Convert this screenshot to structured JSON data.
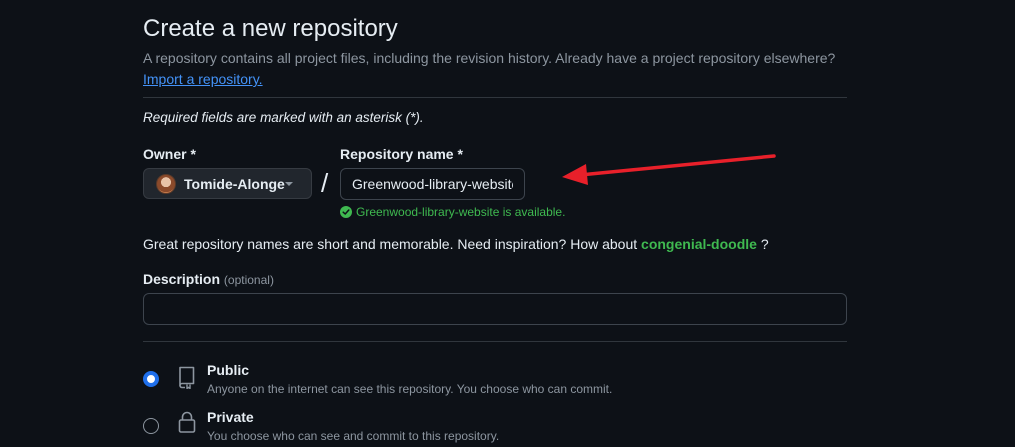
{
  "header": {
    "title": "Create a new repository",
    "subtitle": "A repository contains all project files, including the revision history. Already have a project repository elsewhere?",
    "import_link": "Import a repository."
  },
  "form": {
    "required_note": "Required fields are marked with an asterisk (*).",
    "owner": {
      "label": "Owner *",
      "value": "Tomide-Alonge",
      "avatar_icon": "user-avatar"
    },
    "separator": "/",
    "repo_name": {
      "label": "Repository name *",
      "value": "Greenwood-library-website",
      "availability": "Greenwood-library-website is available."
    },
    "inspiration": {
      "text": "Great repository names are short and memorable. Need inspiration? How about",
      "suggestion": "congenial-doodle",
      "end": "?"
    },
    "description": {
      "label": "Description",
      "optional": "(optional)",
      "value": ""
    },
    "visibility": [
      {
        "title": "Public",
        "description": "Anyone on the internet can see this repository. You choose who can commit.",
        "icon": "repo-icon",
        "selected": true
      },
      {
        "title": "Private",
        "description": "You choose who can see and commit to this repository.",
        "icon": "lock-icon",
        "selected": false
      }
    ]
  },
  "annotation": {
    "arrow_color": "#e8202a"
  },
  "colors": {
    "background": "#0d1117",
    "accent_link": "#4493f8",
    "success": "#3fb950",
    "radio_selected": "#1f6feb"
  }
}
